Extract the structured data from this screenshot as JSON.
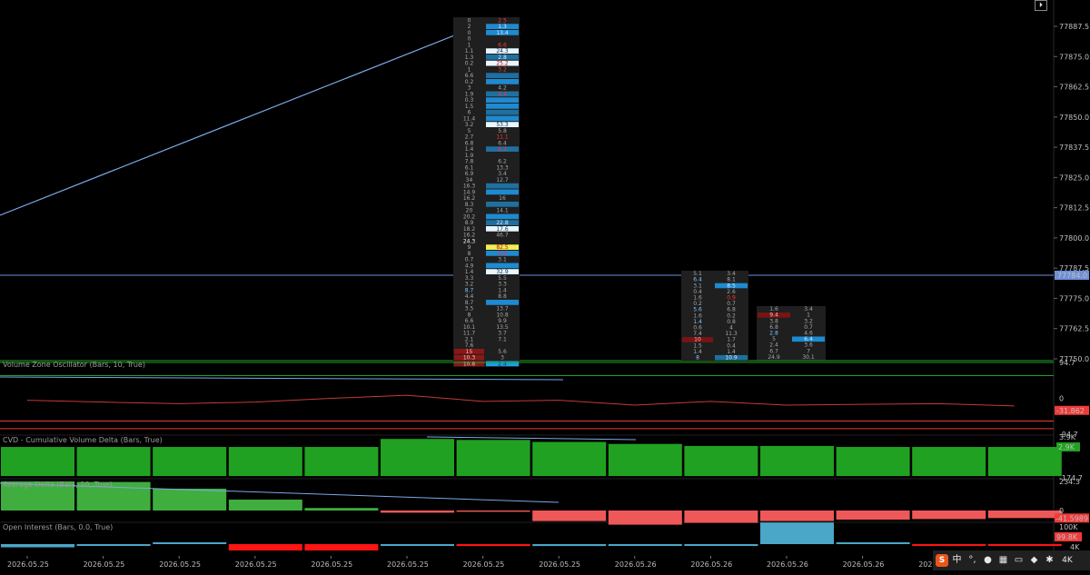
{
  "colors": {
    "bg": "#000000",
    "grid": "#1c1c1c",
    "green": "#21a121",
    "red": "#ef3b3b",
    "blue_line": "#7aa8e8",
    "cyan": "#4aa7c7",
    "cyan_bright": "#19a0e8",
    "white_cell": "#e8f6ff",
    "yellow": "#f2ee55",
    "dark_red": "#7a1414"
  },
  "icons": {
    "corner_button": "collapse-right-icon",
    "tray": [
      "app-logo-icon",
      "chinese-input-icon",
      "punctuation-icon",
      "microphone-icon",
      "keyboard-icon",
      "clipboard-icon",
      "skin-icon",
      "settings-icon"
    ]
  },
  "corner_button_glyph": "⏵",
  "main": {
    "price_axis": [
      "77887.5",
      "77875.0",
      "77862.5",
      "77850.0",
      "77837.5",
      "77825.0",
      "77812.5",
      "77800.0",
      "77787.5",
      "77775.0",
      "77762.5",
      "77750.0"
    ],
    "current_price": "77784.0",
    "footprint1": {
      "left": [
        "0",
        "2",
        "0",
        "0",
        "1",
        "1.1",
        "1.3",
        "0.2",
        "1",
        "6.6",
        "0.2",
        "3",
        "1.9",
        "0.3",
        "1.5",
        "6",
        "11.4",
        "3.2",
        "5",
        "2.7",
        "6.8",
        "1.4",
        "1.9",
        "7.8",
        "6.1",
        "6.9",
        "34",
        "16.3",
        "14.9",
        "16.2",
        "8.3",
        "20",
        "20.2",
        "8.9",
        "18.2",
        "16.2",
        "24.3",
        "9",
        "8",
        "0.7",
        "4.9",
        "1.4",
        "3.3",
        "3.2",
        "8.7",
        "4.4",
        "8.7",
        "3.5",
        "8",
        "6.6",
        "10.1",
        "11.7",
        "2.1",
        "7.6",
        "15",
        "10.3",
        "10.8"
      ],
      "right": [
        "2.5",
        "1.3",
        "13.4",
        "",
        "6.6",
        "24.3",
        "2.8",
        "25.2",
        "3.2",
        "",
        "",
        "4.2",
        "9.4",
        "",
        "",
        "",
        "",
        "53.3",
        "5.8",
        "11.1",
        "6.4",
        "8.2",
        "",
        "6.2",
        "13.3",
        "3.4",
        "12.7",
        "",
        "",
        "16",
        "",
        "14.1",
        "",
        "22.8",
        "17.6",
        "46.7",
        "",
        "82.5",
        "9.9",
        "3.1",
        "",
        "32.9",
        "5.5",
        "3.3",
        "1.4",
        "8.8",
        "",
        "13.7",
        "10.8",
        "9.9",
        "13.5",
        "3.7",
        "7.1",
        "",
        "5.6",
        "3",
        "2.4",
        ""
      ]
    },
    "footprint2": {
      "left": [
        "5.1",
        "6.4",
        "3.1",
        "0.4",
        "1.6",
        "0.2",
        "5.6",
        "1.6",
        "1.4",
        "0.6",
        "7.4",
        "10",
        "1.5",
        "1.4",
        "8"
      ],
      "right": [
        "3.4",
        "8.1",
        "8.5",
        "2.6",
        "0.9",
        "0.7",
        "6.8",
        "0.2",
        "0.8",
        "4",
        "11.3",
        "1.7",
        "0.4",
        "1.4",
        "10.9"
      ]
    },
    "footprint3": {
      "left": [
        "1.6",
        "9.4",
        "3.8",
        "6.8",
        "2.8",
        "5",
        "2.4",
        "6.7",
        "24.9"
      ],
      "right": [
        "3.4",
        "1",
        "3.2",
        "0.7",
        "4.6",
        "6.4",
        "3.6",
        "7",
        "30.1"
      ]
    }
  },
  "panels": {
    "vzo": {
      "title": "Volume Zone Oscillator (Bars, 10, True)",
      "axis": [
        "94.7",
        "0",
        "-94.7"
      ],
      "current": "-31.862"
    },
    "cvd": {
      "title": "CVD - Cumulative Volume Delta (Bars, True)",
      "axis": [
        "3.9K",
        "2.9K",
        "-174.7"
      ],
      "current": "2.9K"
    },
    "avgdelta": {
      "title": "Average Delta (Bars, 10, True)",
      "axis": [
        "234.3",
        "0"
      ],
      "current": "-41.5989"
    },
    "oi": {
      "title": "Open Interest (Bars, 0.0, True)",
      "axis": [
        "100K",
        "4K"
      ],
      "current": "99.8K"
    }
  },
  "chart_data": [
    {
      "type": "line",
      "title": "Volume Zone Oscillator (Bars, 10, True)",
      "x": [
        1,
        2,
        3,
        4,
        5,
        6,
        7,
        8,
        9,
        10,
        11,
        12,
        13,
        14
      ],
      "series": [
        {
          "values": [
            -5,
            -10,
            -14,
            -10,
            0,
            8,
            -8,
            -5,
            -18,
            -8,
            -18,
            -16,
            -14,
            -20
          ]
        }
      ],
      "ylim": [
        -94.7,
        94.7
      ]
    },
    {
      "type": "bar",
      "title": "CVD - Cumulative Volume Delta (Bars, True)",
      "categories": [
        "2026.05.25",
        "2026.05.25",
        "2026.05.25",
        "2026.05.25",
        "2026.05.25",
        "2026.05.25",
        "2026.05.25",
        "2026.05.25",
        "2026.05.26",
        "2026.05.26",
        "2026.05.26",
        "2026.05.26",
        "2026.05.26",
        "2026.05.26"
      ],
      "values": [
        2.9,
        2.9,
        2.9,
        2.9,
        2.9,
        3.7,
        3.6,
        3.4,
        3.2,
        3.0,
        3.0,
        2.9,
        2.9,
        2.9
      ],
      "ylim": [
        -0.1747,
        3.9
      ]
    },
    {
      "type": "bar",
      "title": "Average Delta (Bars, 10, True)",
      "categories": [
        "2026.05.25",
        "2026.05.25",
        "2026.05.25",
        "2026.05.25",
        "2026.05.25",
        "2026.05.25",
        "2026.05.25",
        "2026.05.25",
        "2026.05.26",
        "2026.05.26",
        "2026.05.26",
        "2026.05.26",
        "2026.05.26",
        "2026.05.26"
      ],
      "values": [
        234.3,
        230,
        176,
        88,
        20,
        -12,
        -7,
        -58,
        -78,
        -68,
        -58,
        -50,
        -47,
        -41.5989
      ],
      "ylim": [
        -60,
        234.3
      ]
    },
    {
      "type": "bar",
      "title": "Open Interest (Bars, 0.0, True)",
      "categories": [
        "2026.05.25",
        "2026.05.25",
        "2026.05.25",
        "2026.05.25",
        "2026.05.25",
        "2026.05.25",
        "2026.05.25",
        "2026.05.25",
        "2026.05.26",
        "2026.05.26",
        "2026.05.26",
        "2026.05.26",
        "2026.05.26",
        "2026.05.26"
      ],
      "values": [
        -10,
        -2,
        5,
        -20,
        -20,
        -4,
        -6,
        -6,
        -3,
        -4,
        68,
        3,
        -3,
        -3
      ]
    }
  ],
  "time_axis": [
    "2026.05.25",
    "2026.05.25",
    "2026.05.25",
    "2026.05.25",
    "2026.05.25",
    "2026.05.25",
    "2026.05.25",
    "2026.05.25",
    "2026.05.26",
    "2026.05.26",
    "2026.05.26",
    "2026.05.26",
    "2026.05.26",
    "2026.05.26",
    "2026"
  ],
  "tray": {
    "ime": "中",
    "punct": "°,",
    "quality": "4K"
  }
}
